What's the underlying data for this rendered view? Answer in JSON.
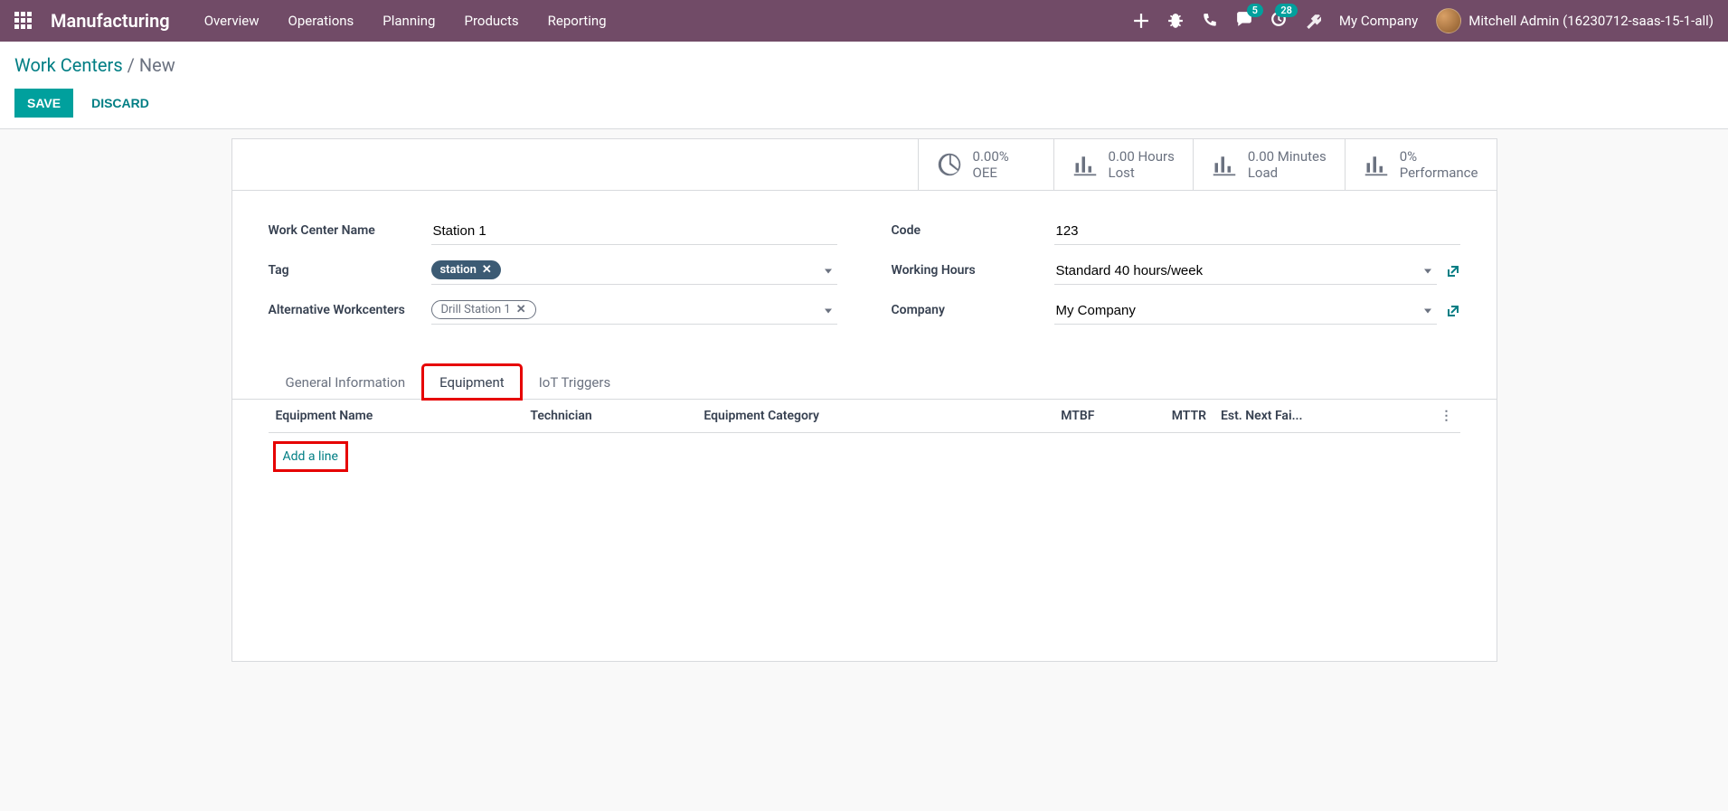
{
  "nav": {
    "brand": "Manufacturing",
    "menu": [
      "Overview",
      "Operations",
      "Planning",
      "Products",
      "Reporting"
    ],
    "badges": {
      "messages": "5",
      "activities": "28"
    },
    "company": "My Company",
    "user": "Mitchell Admin (16230712-saas-15-1-all)"
  },
  "breadcrumb": {
    "root": "Work Centers",
    "sep": "/",
    "current": "New"
  },
  "buttons": {
    "save": "Save",
    "discard": "Discard"
  },
  "stats": [
    {
      "id": "oee",
      "icon": "pie",
      "value": "0.00%",
      "label": "OEE"
    },
    {
      "id": "lost",
      "icon": "bar",
      "value": "0.00 Hours",
      "label": "Lost"
    },
    {
      "id": "load",
      "icon": "bar",
      "value": "0.00 Minutes",
      "label": "Load"
    },
    {
      "id": "perf",
      "icon": "bar",
      "value": "0%",
      "label": "Performance"
    }
  ],
  "form": {
    "name_label": "Work Center Name",
    "name_value": "Station 1",
    "tag_label": "Tag",
    "tag_value": "station",
    "alt_label": "Alternative Workcenters",
    "alt_value": "Drill Station 1",
    "code_label": "Code",
    "code_value": "123",
    "hours_label": "Working Hours",
    "hours_value": "Standard 40 hours/week",
    "company_label": "Company",
    "company_value": "My Company"
  },
  "tabs": [
    "General Information",
    "Equipment",
    "IoT Triggers"
  ],
  "active_tab": 1,
  "table": {
    "columns": [
      "Equipment Name",
      "Technician",
      "Equipment Category",
      "MTBF",
      "MTTR",
      "Est. Next Fai..."
    ],
    "add_line": "Add a line"
  }
}
